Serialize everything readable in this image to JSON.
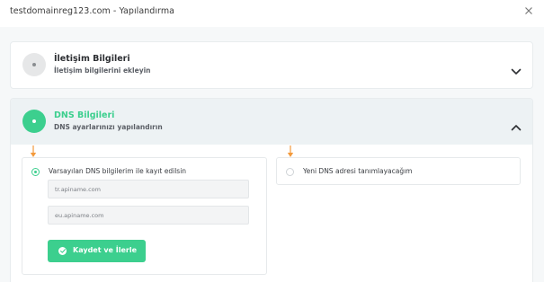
{
  "modal": {
    "title": "testdomainreg123.com - Yapılandırma"
  },
  "contact_section": {
    "title": "İletişim Bilgileri",
    "subtitle": "İletişim bilgilerini ekleyin"
  },
  "dns_section": {
    "title": "DNS Bilgileri",
    "subtitle": "DNS ayarlarınızı yapılandırın",
    "options": [
      {
        "label": "Varsayılan DNS bilgilerim ile kayıt edilsin",
        "selected": true
      },
      {
        "label": "Yeni DNS adresi tanımlayacağım",
        "selected": false
      }
    ],
    "nameservers": [
      "tr.apiname.com",
      "eu.apiname.com"
    ],
    "save_label": "Kaydet ve İlerle"
  },
  "colors": {
    "accent": "#3ccf8e",
    "annotation_arrow": "#f39a3c"
  },
  "icons": [
    "close-icon",
    "chevron-down-icon",
    "chevron-up-icon",
    "check-circle-icon",
    "down-arrow-icon"
  ]
}
